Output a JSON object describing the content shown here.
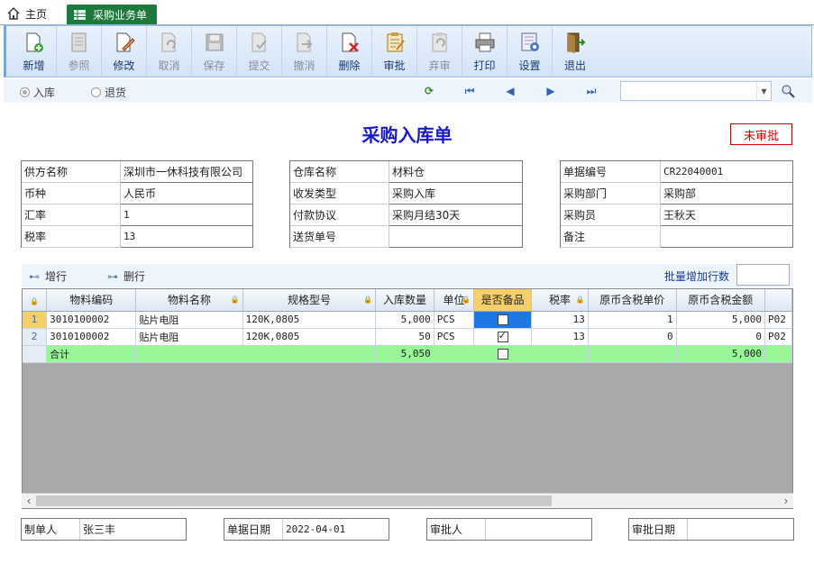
{
  "tabs": {
    "home": "主页",
    "active": "采购业务单"
  },
  "toolbar": [
    {
      "label": "新增",
      "icon": "add-document-icon",
      "enabled": true
    },
    {
      "label": "参照",
      "icon": "reference-icon",
      "enabled": false
    },
    {
      "label": "修改",
      "icon": "edit-icon",
      "enabled": true
    },
    {
      "label": "取消",
      "icon": "cancel-icon",
      "enabled": false
    },
    {
      "label": "保存",
      "icon": "save-icon",
      "enabled": false
    },
    {
      "label": "提交",
      "icon": "submit-icon",
      "enabled": false
    },
    {
      "label": "撤消",
      "icon": "revoke-icon",
      "enabled": false
    },
    {
      "label": "删除",
      "icon": "delete-icon",
      "enabled": true
    },
    {
      "label": "审批",
      "icon": "approve-icon",
      "enabled": true
    },
    {
      "label": "弃审",
      "icon": "unapprove-icon",
      "enabled": false
    },
    {
      "label": "打印",
      "icon": "print-icon",
      "enabled": true
    },
    {
      "label": "设置",
      "icon": "settings-icon",
      "enabled": true
    },
    {
      "label": "退出",
      "icon": "exit-icon",
      "enabled": true
    }
  ],
  "options": {
    "in": "入库",
    "return": "退货"
  },
  "doc_title": "采购入库单",
  "status": "未审批",
  "left_fields": [
    {
      "label": "供方名称",
      "value": "深圳市一休科技有限公司"
    },
    {
      "label": "币种",
      "value": "人民币"
    },
    {
      "label": "汇率",
      "value": "1"
    },
    {
      "label": "税率",
      "value": "13"
    }
  ],
  "mid_fields": [
    {
      "label": "仓库名称",
      "value": "材料仓"
    },
    {
      "label": "收发类型",
      "value": "采购入库"
    },
    {
      "label": "付款协议",
      "value": "采购月结30天"
    },
    {
      "label": "送货单号",
      "value": ""
    }
  ],
  "right_fields": [
    {
      "label": "单据编号",
      "value": "CR22040001"
    },
    {
      "label": "采购部门",
      "value": "采购部"
    },
    {
      "label": "采购员",
      "value": "王秋天"
    },
    {
      "label": "备注",
      "value": ""
    }
  ],
  "grid_tools": {
    "add_row": "增行",
    "del_row": "删行",
    "batch": "批量增加行数"
  },
  "columns": [
    "物料编码",
    "物料名称",
    "规格型号",
    "入库数量",
    "单位",
    "是否备品",
    "税率",
    "原币含税单价",
    "原币含税金额"
  ],
  "rows": [
    {
      "no": "1",
      "code": "3010100002",
      "name": "贴片电阻",
      "spec": "120K,0805",
      "qty": "5,000",
      "unit": "PCS",
      "spare": false,
      "tax": "13",
      "price": "1",
      "amount": "5,000",
      "extra": "P02"
    },
    {
      "no": "2",
      "code": "3010100002",
      "name": "贴片电阻",
      "spec": "120K,0805",
      "qty": "50",
      "unit": "PCS",
      "spare": true,
      "tax": "13",
      "price": "0",
      "amount": "0",
      "extra": "P02"
    }
  ],
  "total": {
    "label": "合计",
    "qty": "5,050",
    "amount": "5,000"
  },
  "footer": [
    {
      "label": "制单人",
      "value": "张三丰"
    },
    {
      "label": "单据日期",
      "value": "2022-04-01"
    },
    {
      "label": "审批人",
      "value": ""
    },
    {
      "label": "审批日期",
      "value": ""
    }
  ]
}
